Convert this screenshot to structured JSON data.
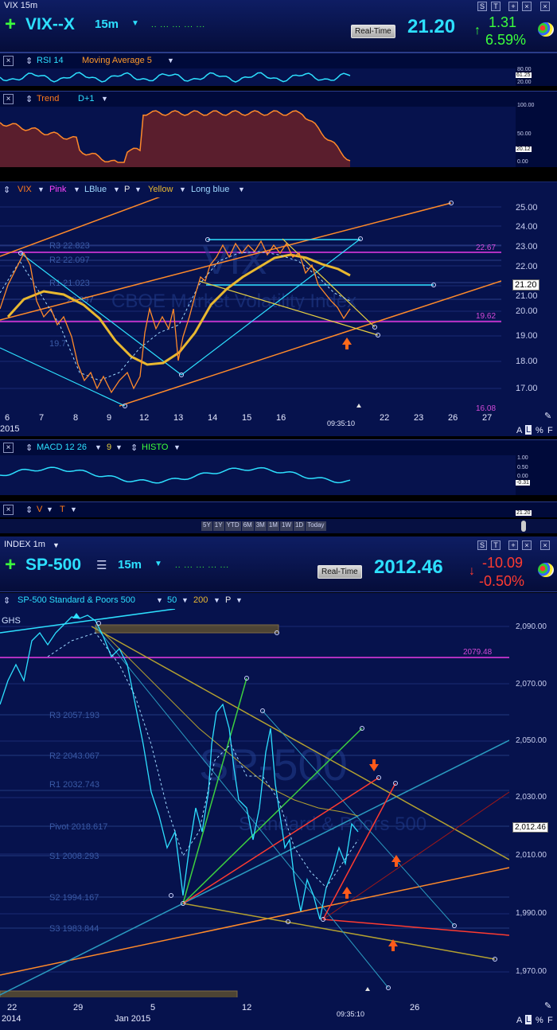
{
  "vix": {
    "window_title": "VIX  15m",
    "symbol": "VIX--X",
    "interval": "15m",
    "realtime": "Real-Time",
    "price": "21.20",
    "change": "1.31",
    "change_pct": "6.59%",
    "rsi_header": [
      "RSI 14",
      "Moving Average 5"
    ],
    "rsi_levels": [
      "80.00",
      "61.25",
      "20.00"
    ],
    "trend_header": [
      "Trend",
      "D+1"
    ],
    "trend_levels": [
      "100.00",
      "50.00",
      "20.12",
      "0.00"
    ],
    "main_header": [
      "VIX",
      "Pink",
      "LBlue",
      "P",
      "Yellow",
      "Long blue"
    ],
    "y_ticks": [
      "25.00",
      "24.00",
      "23.00",
      "22.00",
      "21.00",
      "20.00",
      "19.00",
      "18.00",
      "17.00"
    ],
    "levels": {
      "r3": "R3 22.823",
      "r2": "R2 22.097",
      "r1": "R1 21.023",
      "pivot": "20.297",
      "s1": "19.7",
      "lev_2267": "22.67",
      "lev_1962": "19.62",
      "lev_1608": "16.08",
      "last": "21.20"
    },
    "watermark1": "VIX",
    "watermark2": "CBOE Market Volatility Index",
    "x_ticks": [
      "6",
      "7",
      "8",
      "9",
      "12",
      "13",
      "14",
      "15",
      "16",
      "22",
      "23",
      "26",
      "27"
    ],
    "year": "2015",
    "time": "09:35:10",
    "alf": [
      "A",
      "L",
      "%",
      "F"
    ],
    "macd_header": [
      "MACD 12 26",
      "9",
      "HISTO"
    ],
    "macd_levels": [
      "1.00",
      "0.50",
      "0.00",
      "-0.31"
    ],
    "v_header": [
      "V",
      "T"
    ],
    "v_value": "21.20",
    "ranges": [
      "5Y",
      "1Y",
      "YTD",
      "6M",
      "3M",
      "1M",
      "1W",
      "1D",
      "Today"
    ]
  },
  "spx": {
    "window_title": "INDEX  1m",
    "symbol": "SP-500",
    "interval": "15m",
    "realtime": "Real-Time",
    "price": "2012.46",
    "change": "-10.09",
    "change_pct": "-0.50%",
    "main_header": [
      "SP-500 Standard & Poors 500",
      "50",
      "200",
      "P"
    ],
    "ghs": "GHS",
    "y_ticks": [
      "2,090.00",
      "2,070.00",
      "2,050.00",
      "2,030.00",
      "2,010.00",
      "1,990.00",
      "1,970.00"
    ],
    "levels": {
      "r3": "R3 2057.193",
      "r2": "R2 2043.067",
      "r1": "R1 2032.743",
      "pivot": "Pivot 2018.617",
      "s1": "S1 2008.293",
      "s2": "S2 1994.167",
      "s3": "S3 1983.844",
      "lev_207948": "2079.48",
      "last": "2,012.46"
    },
    "watermark1": "SP-500",
    "watermark2": "Standard & Poors 500",
    "x_ticks": [
      "22",
      "29",
      "5",
      "12",
      "26"
    ],
    "x_sub": [
      "2014",
      "Jan 2015"
    ],
    "time": "09:35:10",
    "alf": [
      "A",
      "L",
      "%",
      "F"
    ]
  },
  "colors": {
    "bg": "#06124d",
    "accent_cyan": "#2de0ff",
    "green": "#3cff3c",
    "red": "#ff3b30",
    "orange": "#ff7a1a",
    "yellow": "#e8b830"
  }
}
